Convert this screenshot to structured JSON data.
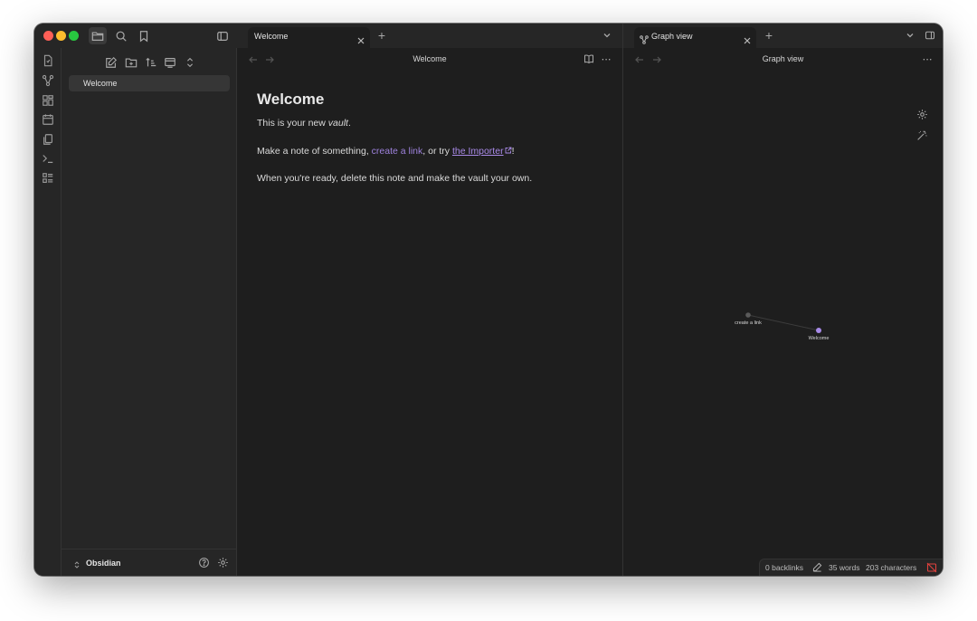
{
  "left_tab": {
    "title": "Welcome",
    "new_tab_label": "+"
  },
  "right_tab": {
    "title": "Graph view",
    "new_tab_label": "+"
  },
  "sidebar": {
    "files": [
      {
        "label": "Welcome"
      }
    ],
    "vault_name": "Obsidian"
  },
  "editor": {
    "header_title": "Welcome",
    "heading": "Welcome",
    "p1_prefix": "This is your new ",
    "p1_em": "vault",
    "p1_suffix": ".",
    "p2_prefix": "Make a note of something, ",
    "p2_link": "create a link",
    "p2_middle": ", or try ",
    "p2_ext_link": "the Importer",
    "p2_suffix": "!",
    "p3": "When you're ready, delete this note and make the vault your own."
  },
  "graph": {
    "header_title": "Graph view",
    "nodes": [
      {
        "label": "create a link",
        "color": "#5a5a5a"
      },
      {
        "label": "Welcome",
        "color": "#a88be8"
      }
    ]
  },
  "status": {
    "backlinks": "0 backlinks",
    "words": "35 words",
    "characters": "203 characters"
  },
  "colors": {
    "accent": "#a88be8",
    "background": "#1e1e1e",
    "chrome": "#262626",
    "traffic_red": "#fe5f57",
    "traffic_yellow": "#febc2e",
    "traffic_green": "#28c840",
    "sync_error": "#e0413d"
  }
}
